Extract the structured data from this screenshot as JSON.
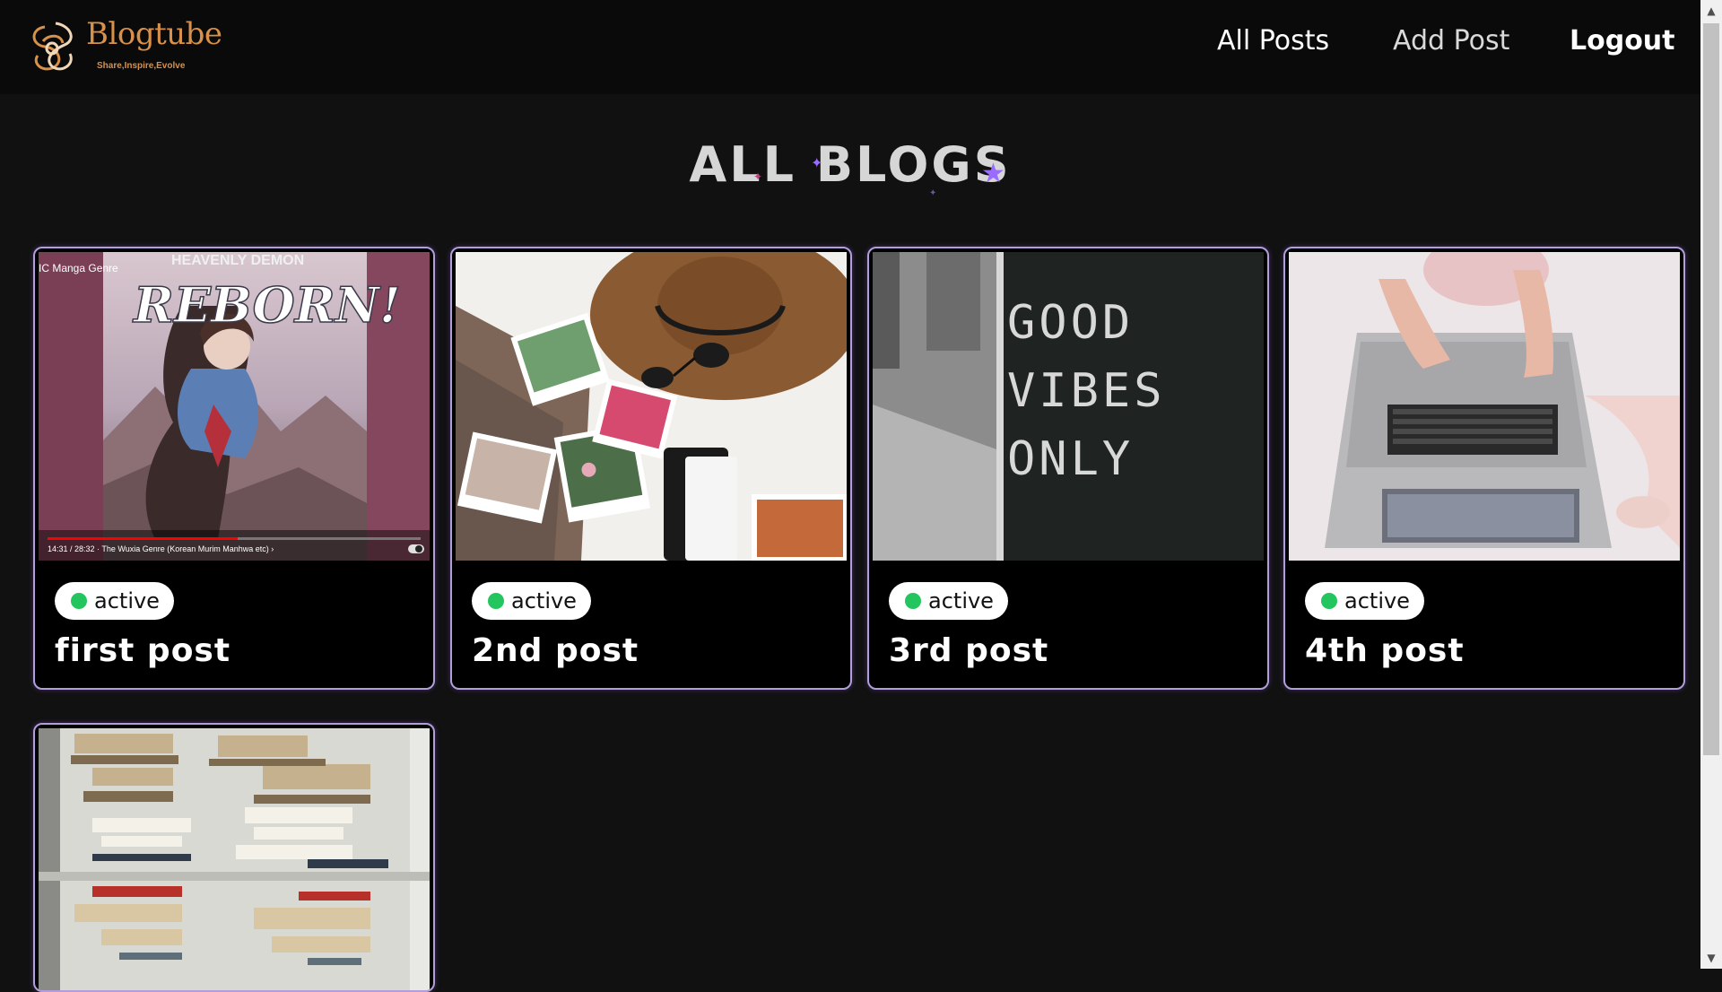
{
  "brand": {
    "name": "Blogtube",
    "tagline": "Share,Inspire,Evolve",
    "accent_color": "#d8914a",
    "logo_icon": "swirl-logo-icon"
  },
  "nav": {
    "all_posts": "All Posts",
    "add_post": "Add Post",
    "logout": "Logout"
  },
  "page": {
    "title": "ALL BLOGS"
  },
  "colors": {
    "card_border": "#b39ddb",
    "status_active": "#22c55e",
    "sparkle": "#9b6bff"
  },
  "posts": [
    {
      "title": "first post",
      "status": "active",
      "image": {
        "kind": "anime-video-thumbnail",
        "overlay_top_left": "IC Manga Genre",
        "banner_small": "HEAVENLY DEMON",
        "banner_large": "REBORN!",
        "player_caption": "14:31 / 28:32 · The Wuxia Genre (Korean Murim Manhwa etc) ›",
        "progress": 0.51
      }
    },
    {
      "title": "2nd post",
      "status": "active",
      "image": {
        "kind": "hat-and-photos-flatlay"
      }
    },
    {
      "title": "3rd post",
      "status": "active",
      "image": {
        "kind": "letter-board",
        "board_lines": [
          "GOOD",
          "VIBES",
          "ONLY"
        ]
      }
    },
    {
      "title": "4th post",
      "status": "active",
      "image": {
        "kind": "laptop-on-bed"
      }
    },
    {
      "title": "",
      "status": "",
      "image": {
        "kind": "bookshelf-stacks"
      }
    }
  ]
}
